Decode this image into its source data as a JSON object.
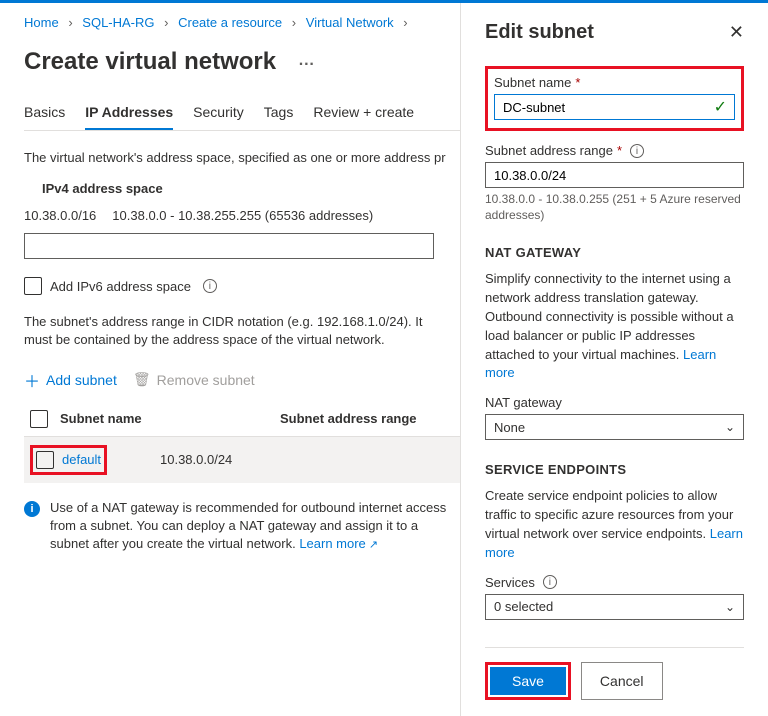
{
  "breadcrumbs": [
    "Home",
    "SQL-HA-RG",
    "Create a resource",
    "Virtual Network"
  ],
  "page_title": "Create virtual network",
  "tabs": [
    "Basics",
    "IP Addresses",
    "Security",
    "Tags",
    "Review + create"
  ],
  "active_tab_index": 1,
  "desc_text": "The virtual network's address space, specified as one or more address pr",
  "ipv4_label": "IPv4 address space",
  "ipv4_cidr": "10.38.0.0/16",
  "ipv4_range": "10.38.0.0 - 10.38.255.255 (65536 addresses)",
  "ipv6_checkbox": "Add IPv6 address space",
  "subnet_desc": "The subnet's address range in CIDR notation (e.g. 192.168.1.0/24). It must be contained by the address space of the virtual network.",
  "toolbar": {
    "add": "Add subnet",
    "remove": "Remove subnet"
  },
  "subnet_table": {
    "col_name": "Subnet name",
    "col_range": "Subnet address range",
    "row_name": "default",
    "row_range": "10.38.0.0/24"
  },
  "nat_info": "Use of a NAT gateway is recommended for outbound internet access from a subnet. You can deploy a NAT gateway and assign it to a subnet after you create the virtual network.",
  "learn_more": "Learn more",
  "panel": {
    "title": "Edit subnet",
    "subnet_name_label": "Subnet name",
    "subnet_name_value": "DC-subnet",
    "subnet_range_label": "Subnet address range",
    "subnet_range_value": "10.38.0.0/24",
    "subnet_range_hint": "10.38.0.0 - 10.38.0.255 (251 + 5 Azure reserved addresses)",
    "nat_heading": "NAT GATEWAY",
    "nat_text": "Simplify connectivity to the internet using a network address translation gateway. Outbound connectivity is possible without a load balancer or public IP addresses attached to your virtual machines.",
    "nat_gateway_label": "NAT gateway",
    "nat_gateway_value": "None",
    "se_heading": "SERVICE ENDPOINTS",
    "se_text": "Create service endpoint policies to allow traffic to specific azure resources from your virtual network over service endpoints.",
    "services_label": "Services",
    "services_value": "0 selected",
    "save": "Save",
    "cancel": "Cancel"
  }
}
